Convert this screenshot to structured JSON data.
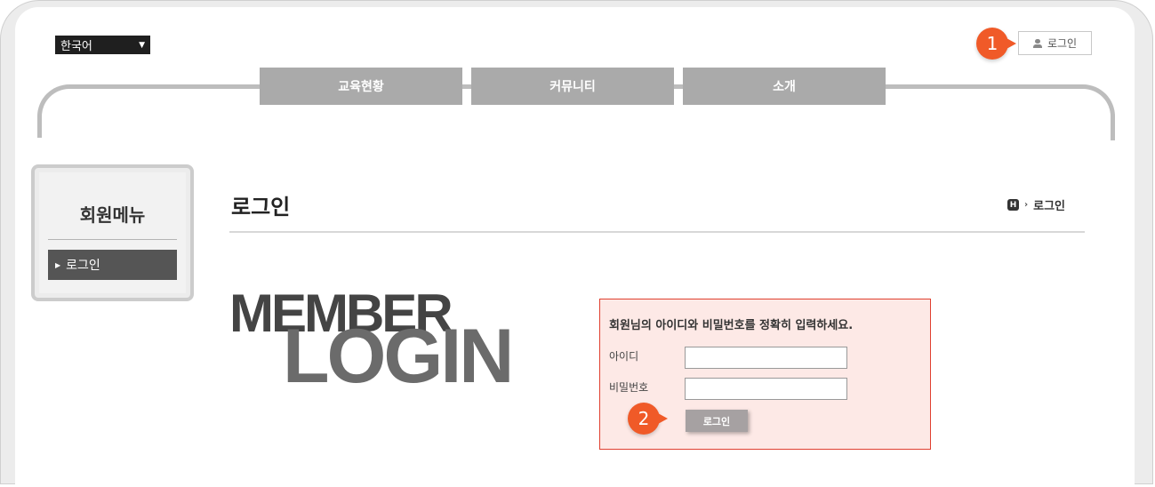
{
  "header": {
    "language": "한국어",
    "login_link": "로그인"
  },
  "badges": [
    "1",
    "2"
  ],
  "nav": {
    "items": [
      {
        "label": "교육현황"
      },
      {
        "label": "커뮤니티"
      },
      {
        "label": "소개"
      }
    ]
  },
  "sidebar": {
    "title": "회원메뉴",
    "items": [
      {
        "label": "로그인"
      }
    ]
  },
  "main": {
    "title": "로그인",
    "breadcrumb": {
      "home_icon_text": "H",
      "current": "로그인"
    },
    "hero": {
      "line1": "MEMBER",
      "line2": "LOGIN"
    }
  },
  "login_form": {
    "message": "회원님의 아이디와 비밀번호를 정확히 입력하세요.",
    "id_label": "아이디",
    "id_value": "",
    "password_label": "비밀번호",
    "password_value": "",
    "submit_label": "로그인"
  },
  "colors": {
    "accent_badge": "#f05a28",
    "nav_bg": "#aaaaaa",
    "form_border": "#e04030",
    "form_bg": "#fde9e6"
  }
}
